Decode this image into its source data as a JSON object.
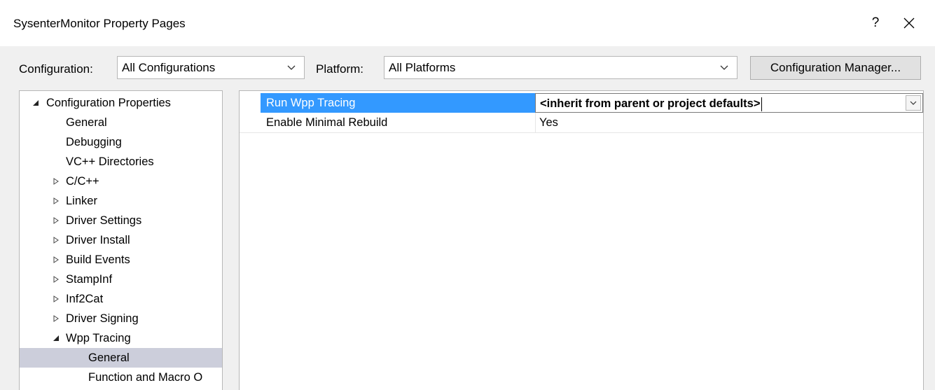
{
  "window": {
    "title": "SysenterMonitor Property Pages",
    "help_label": "?"
  },
  "toolbar": {
    "configuration_label": "Configuration:",
    "configuration_value": "All Configurations",
    "platform_label": "Platform:",
    "platform_value": "All Platforms",
    "config_manager_label": "Configuration Manager..."
  },
  "tree": {
    "items": [
      {
        "label": "Configuration Properties",
        "expander": "expanded",
        "level": 0
      },
      {
        "label": "General",
        "expander": "none",
        "level": 1
      },
      {
        "label": "Debugging",
        "expander": "none",
        "level": 1
      },
      {
        "label": "VC++ Directories",
        "expander": "none",
        "level": 1
      },
      {
        "label": "C/C++",
        "expander": "collapsed",
        "level": 1
      },
      {
        "label": "Linker",
        "expander": "collapsed",
        "level": 1
      },
      {
        "label": "Driver Settings",
        "expander": "collapsed",
        "level": 1
      },
      {
        "label": "Driver Install",
        "expander": "collapsed",
        "level": 1
      },
      {
        "label": "Build Events",
        "expander": "collapsed",
        "level": 1
      },
      {
        "label": "StampInf",
        "expander": "collapsed",
        "level": 1
      },
      {
        "label": "Inf2Cat",
        "expander": "collapsed",
        "level": 1
      },
      {
        "label": "Driver Signing",
        "expander": "collapsed",
        "level": 1
      },
      {
        "label": "Wpp Tracing",
        "expander": "expanded",
        "level": 1
      },
      {
        "label": "General",
        "expander": "none",
        "level": 2,
        "selected": true
      },
      {
        "label": "Function and Macro O",
        "expander": "none",
        "level": 2
      }
    ]
  },
  "properties": {
    "rows": [
      {
        "name": "Run Wpp Tracing",
        "value": "<inherit from parent or project defaults>"
      },
      {
        "name": "Enable Minimal Rebuild",
        "value": "Yes"
      }
    ]
  },
  "colors": {
    "selection_blue": "#3399ff",
    "tree_selection": "#cccedb",
    "dialog_bg": "#f0f0f0"
  }
}
